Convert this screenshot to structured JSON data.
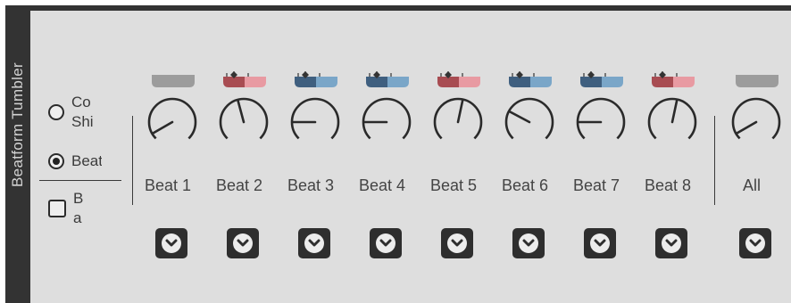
{
  "device": {
    "title": "Beatform Tumbler"
  },
  "options": {
    "radio_1": {
      "line1": "Co",
      "line2": "Shi",
      "selected": false
    },
    "radio_2": {
      "line1": "Beat",
      "selected": true
    },
    "checkbox": {
      "line1": "B",
      "line2": "a",
      "checked": false
    }
  },
  "beats": [
    {
      "label": "Beat 1",
      "knob_angle": -120,
      "swing_style": "gray"
    },
    {
      "label": "Beat 2",
      "knob_angle": -15,
      "swing_style": "red"
    },
    {
      "label": "Beat 3",
      "knob_angle": -90,
      "swing_style": "blue"
    },
    {
      "label": "Beat 4",
      "knob_angle": -90,
      "swing_style": "blue"
    },
    {
      "label": "Beat 5",
      "knob_angle": 12,
      "swing_style": "red"
    },
    {
      "label": "Beat 6",
      "knob_angle": -62,
      "swing_style": "blue"
    },
    {
      "label": "Beat 7",
      "knob_angle": -90,
      "swing_style": "blue"
    },
    {
      "label": "Beat 8",
      "knob_angle": 12,
      "swing_style": "red"
    }
  ],
  "all": {
    "label": "All",
    "knob_angle": -120,
    "swing_style": "gray"
  },
  "colors": {
    "gray": "#9c9c9c",
    "red_dark": "#a84c52",
    "red_light": "#e89aa2",
    "blue_dark": "#3f5f7f",
    "blue_light": "#7aa6c8"
  }
}
